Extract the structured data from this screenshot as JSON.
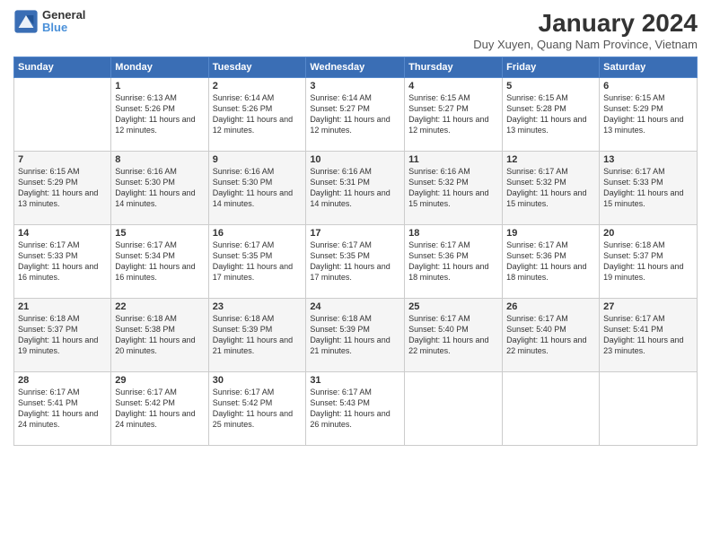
{
  "header": {
    "logo_general": "General",
    "logo_blue": "Blue",
    "month": "January 2024",
    "location": "Duy Xuyen, Quang Nam Province, Vietnam"
  },
  "days_of_week": [
    "Sunday",
    "Monday",
    "Tuesday",
    "Wednesday",
    "Thursday",
    "Friday",
    "Saturday"
  ],
  "weeks": [
    [
      {
        "day": "",
        "info": ""
      },
      {
        "day": "1",
        "info": "Sunrise: 6:13 AM\nSunset: 5:26 PM\nDaylight: 11 hours\nand 12 minutes."
      },
      {
        "day": "2",
        "info": "Sunrise: 6:14 AM\nSunset: 5:26 PM\nDaylight: 11 hours\nand 12 minutes."
      },
      {
        "day": "3",
        "info": "Sunrise: 6:14 AM\nSunset: 5:27 PM\nDaylight: 11 hours\nand 12 minutes."
      },
      {
        "day": "4",
        "info": "Sunrise: 6:15 AM\nSunset: 5:27 PM\nDaylight: 11 hours\nand 12 minutes."
      },
      {
        "day": "5",
        "info": "Sunrise: 6:15 AM\nSunset: 5:28 PM\nDaylight: 11 hours\nand 13 minutes."
      },
      {
        "day": "6",
        "info": "Sunrise: 6:15 AM\nSunset: 5:29 PM\nDaylight: 11 hours\nand 13 minutes."
      }
    ],
    [
      {
        "day": "7",
        "info": "Sunrise: 6:15 AM\nSunset: 5:29 PM\nDaylight: 11 hours\nand 13 minutes."
      },
      {
        "day": "8",
        "info": "Sunrise: 6:16 AM\nSunset: 5:30 PM\nDaylight: 11 hours\nand 14 minutes."
      },
      {
        "day": "9",
        "info": "Sunrise: 6:16 AM\nSunset: 5:30 PM\nDaylight: 11 hours\nand 14 minutes."
      },
      {
        "day": "10",
        "info": "Sunrise: 6:16 AM\nSunset: 5:31 PM\nDaylight: 11 hours\nand 14 minutes."
      },
      {
        "day": "11",
        "info": "Sunrise: 6:16 AM\nSunset: 5:32 PM\nDaylight: 11 hours\nand 15 minutes."
      },
      {
        "day": "12",
        "info": "Sunrise: 6:17 AM\nSunset: 5:32 PM\nDaylight: 11 hours\nand 15 minutes."
      },
      {
        "day": "13",
        "info": "Sunrise: 6:17 AM\nSunset: 5:33 PM\nDaylight: 11 hours\nand 15 minutes."
      }
    ],
    [
      {
        "day": "14",
        "info": "Sunrise: 6:17 AM\nSunset: 5:33 PM\nDaylight: 11 hours\nand 16 minutes."
      },
      {
        "day": "15",
        "info": "Sunrise: 6:17 AM\nSunset: 5:34 PM\nDaylight: 11 hours\nand 16 minutes."
      },
      {
        "day": "16",
        "info": "Sunrise: 6:17 AM\nSunset: 5:35 PM\nDaylight: 11 hours\nand 17 minutes."
      },
      {
        "day": "17",
        "info": "Sunrise: 6:17 AM\nSunset: 5:35 PM\nDaylight: 11 hours\nand 17 minutes."
      },
      {
        "day": "18",
        "info": "Sunrise: 6:17 AM\nSunset: 5:36 PM\nDaylight: 11 hours\nand 18 minutes."
      },
      {
        "day": "19",
        "info": "Sunrise: 6:17 AM\nSunset: 5:36 PM\nDaylight: 11 hours\nand 18 minutes."
      },
      {
        "day": "20",
        "info": "Sunrise: 6:18 AM\nSunset: 5:37 PM\nDaylight: 11 hours\nand 19 minutes."
      }
    ],
    [
      {
        "day": "21",
        "info": "Sunrise: 6:18 AM\nSunset: 5:37 PM\nDaylight: 11 hours\nand 19 minutes."
      },
      {
        "day": "22",
        "info": "Sunrise: 6:18 AM\nSunset: 5:38 PM\nDaylight: 11 hours\nand 20 minutes."
      },
      {
        "day": "23",
        "info": "Sunrise: 6:18 AM\nSunset: 5:39 PM\nDaylight: 11 hours\nand 21 minutes."
      },
      {
        "day": "24",
        "info": "Sunrise: 6:18 AM\nSunset: 5:39 PM\nDaylight: 11 hours\nand 21 minutes."
      },
      {
        "day": "25",
        "info": "Sunrise: 6:17 AM\nSunset: 5:40 PM\nDaylight: 11 hours\nand 22 minutes."
      },
      {
        "day": "26",
        "info": "Sunrise: 6:17 AM\nSunset: 5:40 PM\nDaylight: 11 hours\nand 22 minutes."
      },
      {
        "day": "27",
        "info": "Sunrise: 6:17 AM\nSunset: 5:41 PM\nDaylight: 11 hours\nand 23 minutes."
      }
    ],
    [
      {
        "day": "28",
        "info": "Sunrise: 6:17 AM\nSunset: 5:41 PM\nDaylight: 11 hours\nand 24 minutes."
      },
      {
        "day": "29",
        "info": "Sunrise: 6:17 AM\nSunset: 5:42 PM\nDaylight: 11 hours\nand 24 minutes."
      },
      {
        "day": "30",
        "info": "Sunrise: 6:17 AM\nSunset: 5:42 PM\nDaylight: 11 hours\nand 25 minutes."
      },
      {
        "day": "31",
        "info": "Sunrise: 6:17 AM\nSunset: 5:43 PM\nDaylight: 11 hours\nand 26 minutes."
      },
      {
        "day": "",
        "info": ""
      },
      {
        "day": "",
        "info": ""
      },
      {
        "day": "",
        "info": ""
      }
    ]
  ]
}
